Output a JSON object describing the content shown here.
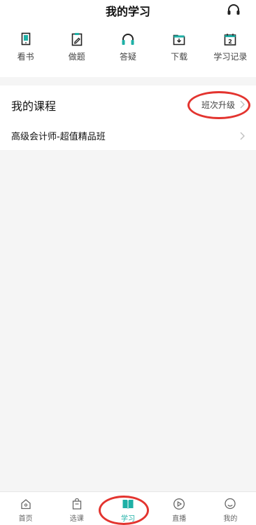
{
  "header": {
    "title": "我的学习"
  },
  "actions": [
    {
      "label": "看书",
      "icon": "tablet-icon"
    },
    {
      "label": "做题",
      "icon": "clipboard-pencil-icon"
    },
    {
      "label": "答疑",
      "icon": "headset-icon"
    },
    {
      "label": "下载",
      "icon": "folder-download-icon"
    },
    {
      "label": "学习记录",
      "icon": "calendar-icon"
    }
  ],
  "course": {
    "title": "我的课程",
    "upgrade_label": "班次升级",
    "items": [
      {
        "name": "高级会计师-超值精品班"
      }
    ]
  },
  "tabbar": {
    "tabs": [
      {
        "label": "首页",
        "icon": "home-icon"
      },
      {
        "label": "选课",
        "icon": "shopping-bag-icon"
      },
      {
        "label": "学习",
        "icon": "book-icon",
        "active": true
      },
      {
        "label": "直播",
        "icon": "play-icon"
      },
      {
        "label": "我的",
        "icon": "smile-icon"
      }
    ]
  },
  "colors": {
    "accent": "#1fb0a6",
    "annotation": "#e3342f",
    "background": "#f5f5f5"
  }
}
